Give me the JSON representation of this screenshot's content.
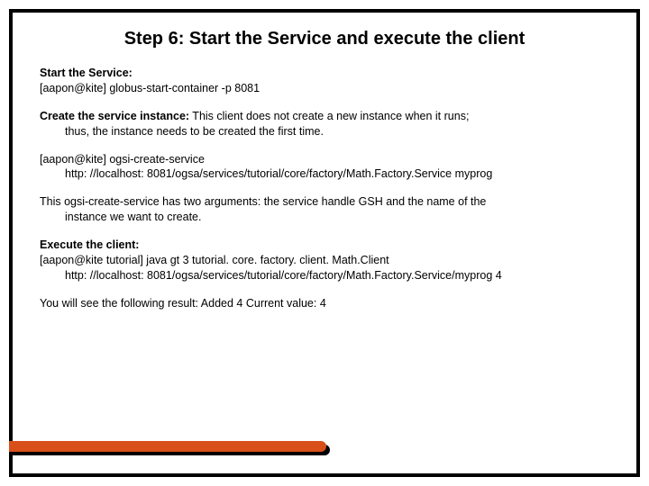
{
  "title_bold": "Step 6:",
  "title_rest": "  Start the Service and execute the client",
  "p1_label": "Start the Service:",
  "p1_line": "[aapon@kite] globus-start-container -p 8081",
  "p2_label": "Create the service instance:",
  "p2_rest": "  This client does not create a new instance when it runs;",
  "p2_line2": "thus, the instance needs to be created the first time.",
  "p3_line1": "[aapon@kite] ogsi-create-service",
  "p3_line2": "http: //localhost: 8081/ogsa/services/tutorial/core/factory/Math.Factory.Service myprog",
  "p4_text": "This ogsi-create-service has two arguments: the service handle GSH and the name of the",
  "p4_line2": "instance we want to create.",
  "p5_label": "Execute the client:",
  "p5_line1": "[aapon@kite tutorial] java gt 3 tutorial. core. factory. client. Math.Client",
  "p5_line2": "http: //localhost: 8081/ogsa/services/tutorial/core/factory/Math.Factory.Service/myprog 4",
  "p6_text": "You will see the following result: Added 4 Current value: 4"
}
